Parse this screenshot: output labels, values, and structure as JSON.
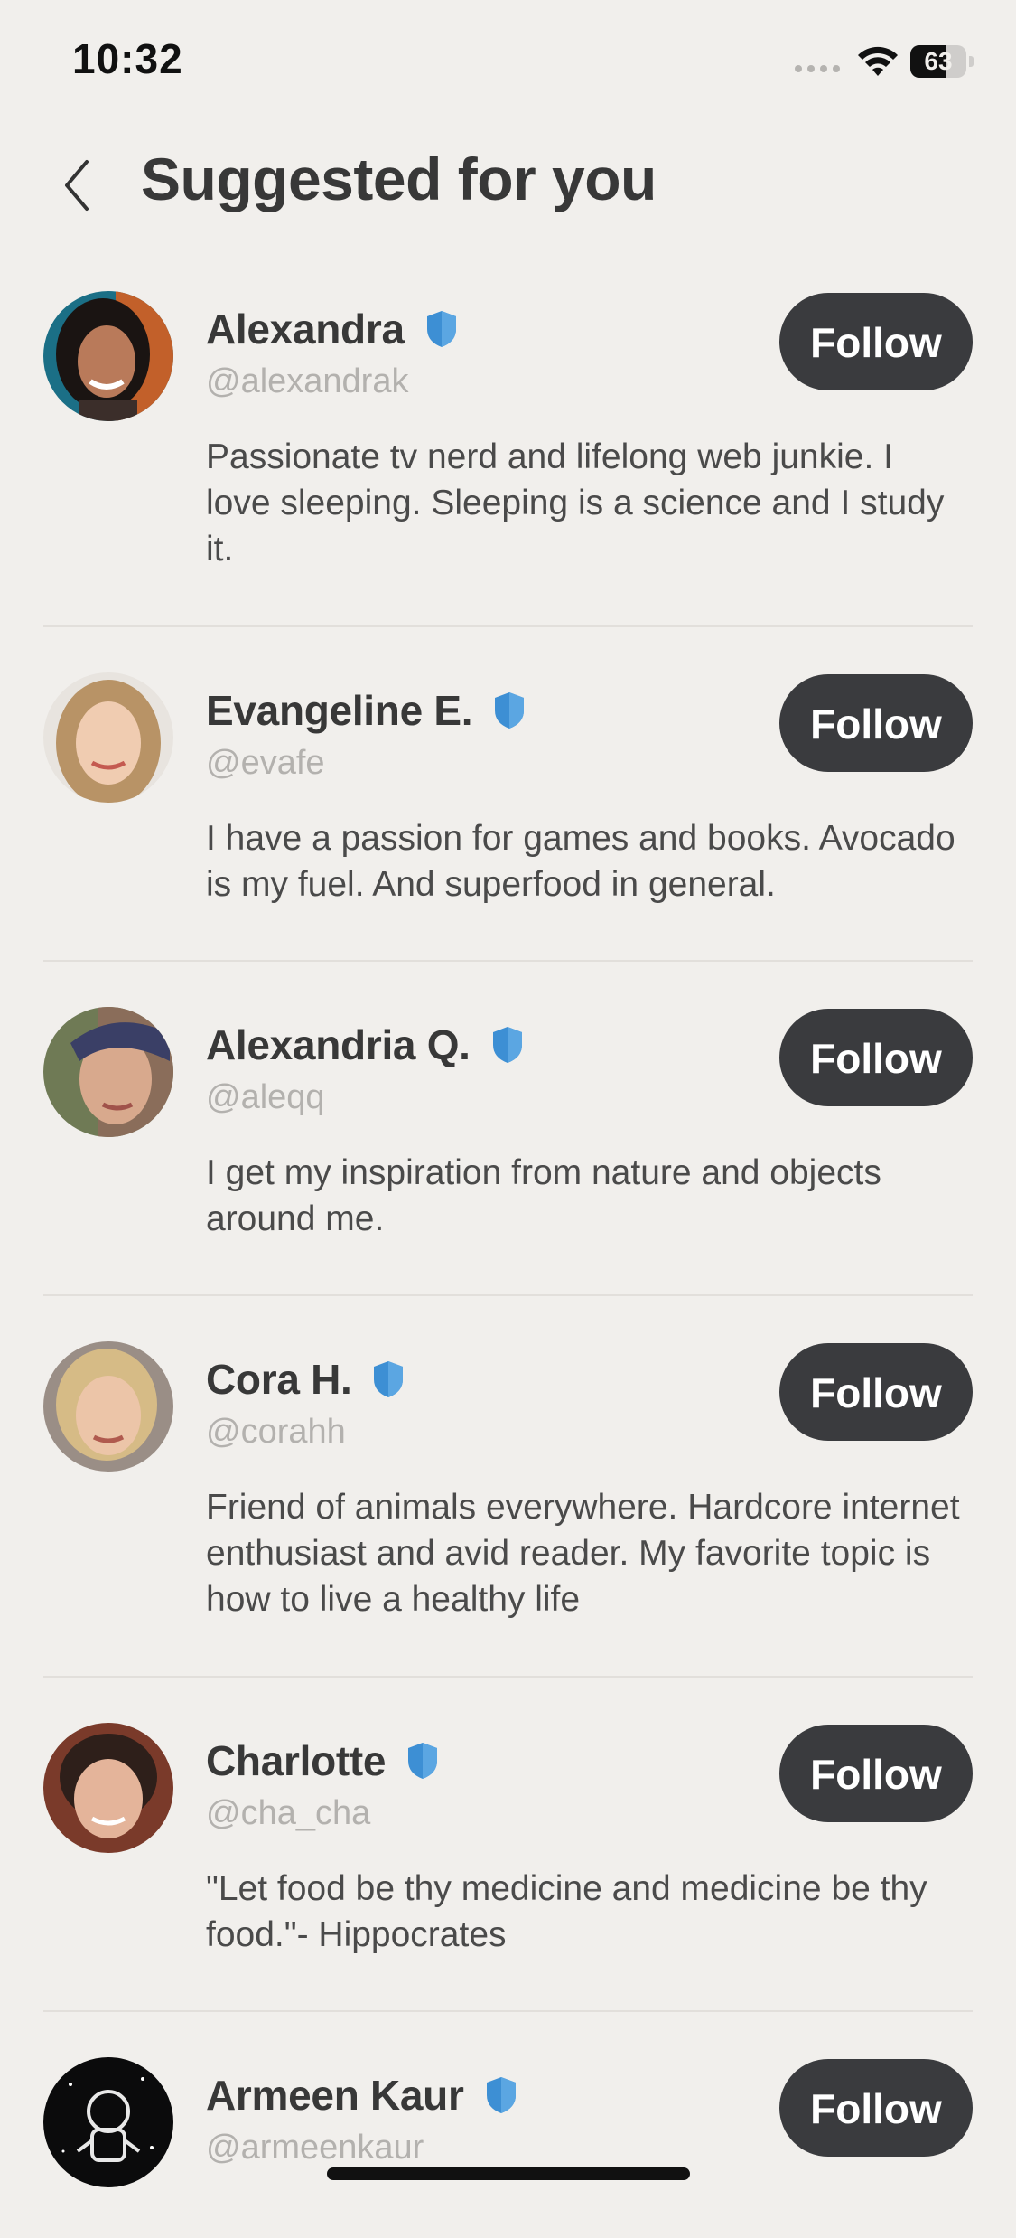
{
  "status_bar": {
    "time": "10:32",
    "battery_level": "63",
    "icons": [
      "signal-dots-icon",
      "wifi-icon",
      "battery-icon"
    ]
  },
  "header": {
    "back_icon": "chevron-left-icon",
    "title": "Suggested for you"
  },
  "colors": {
    "background": "#f1efec",
    "button": "#3a3b3e",
    "verified": "#3d8fd4",
    "handle": "#b3b1ae"
  },
  "users": [
    {
      "name": "Alexandra",
      "handle": "@alexandrak",
      "verified": true,
      "bio": "Passionate tv nerd and lifelong web junkie. I love sleeping. Sleeping is a science and I study it.",
      "follow_label": "Follow"
    },
    {
      "name": "Evangeline E.",
      "handle": "@evafe",
      "verified": true,
      "bio": "I have a passion for games and books. Avocado is my fuel. And superfood in general.",
      "follow_label": "Follow"
    },
    {
      "name": "Alexandria Q.",
      "handle": "@aleqq",
      "verified": true,
      "bio": "I get my inspiration from nature and objects around me.",
      "follow_label": "Follow"
    },
    {
      "name": "Cora H.",
      "handle": "@corahh",
      "verified": true,
      "bio": "Friend of animals everywhere. Hardcore internet enthusiast and avid reader. My favorite topic is how to live a healthy life",
      "follow_label": "Follow"
    },
    {
      "name": "Charlotte",
      "handle": "@cha_cha",
      "verified": true,
      "bio": "\"Let food be thy medicine and medicine be thy food.\"- Hippocrates",
      "follow_label": "Follow"
    },
    {
      "name": "Armeen Kaur",
      "handle": "@armeenkaur",
      "verified": true,
      "bio": "",
      "follow_label": "Follow"
    }
  ]
}
